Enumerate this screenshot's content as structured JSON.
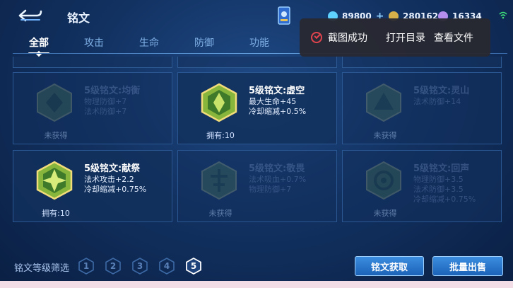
{
  "header": {
    "title": "铭文",
    "currency": [
      {
        "value": "89800",
        "color": "#5fd1ff",
        "has_plus": true
      },
      {
        "value": "280162",
        "color": "#d7b04a",
        "has_plus": false
      },
      {
        "value": "16334",
        "color": "#b58ff0",
        "has_plus": false
      }
    ]
  },
  "tabs": [
    {
      "label": "全部",
      "active": true
    },
    {
      "label": "攻击",
      "active": false
    },
    {
      "label": "生命",
      "active": false
    },
    {
      "label": "防御",
      "active": false
    },
    {
      "label": "功能",
      "active": false
    }
  ],
  "toast": {
    "message": "截图成功",
    "open_dir": "打开目录",
    "view_file": "查看文件"
  },
  "cards": [
    {
      "name": "5级铭文:均衡",
      "stats": [
        "物理防御+7",
        "法术防御+7"
      ],
      "owned": "未获得",
      "obtained": false,
      "color": "#6a9a55"
    },
    {
      "name": "5级铭文:虚空",
      "stats": [
        "最大生命+45",
        "冷却缩减+0.5%"
      ],
      "owned": "拥有:10",
      "obtained": true,
      "color": "#86b83c"
    },
    {
      "name": "5级铭文:灵山",
      "stats": [
        "法术防御+14"
      ],
      "owned": "未获得",
      "obtained": false,
      "color": "#6a9a55"
    },
    {
      "name": "5级铭文:献祭",
      "stats": [
        "法术攻击+2.2",
        "冷却缩减+0.75%"
      ],
      "owned": "拥有:10",
      "obtained": true,
      "color": "#86b83c"
    },
    {
      "name": "5级铭文:敬畏",
      "stats": [
        "法术吸血+0.7%",
        "物理防御+7"
      ],
      "owned": "未获得",
      "obtained": false,
      "color": "#6a9a55"
    },
    {
      "name": "5级铭文:回声",
      "stats": [
        "物理防御+3.5",
        "法术防御+3.5",
        "冷却缩减+0.75%"
      ],
      "owned": "未获得",
      "obtained": false,
      "color": "#6a9a55"
    }
  ],
  "footer": {
    "filter_label": "铭文等级筛选",
    "levels": [
      "1",
      "2",
      "3",
      "4",
      "5"
    ],
    "active_level": "5",
    "get_button": "铭文获取",
    "sell_button": "批量出售"
  }
}
